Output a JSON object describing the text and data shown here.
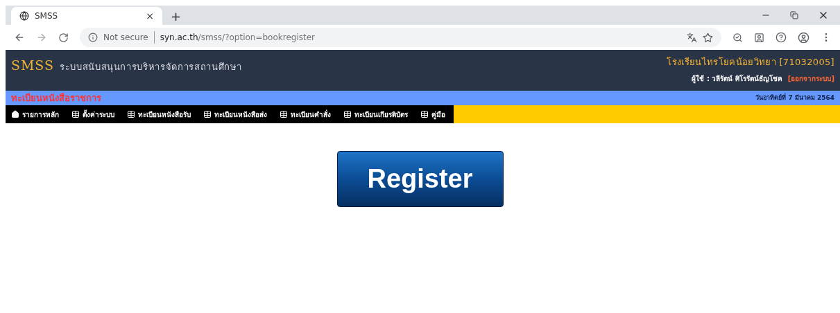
{
  "browser": {
    "tab": {
      "title": "SMSS",
      "close": "×"
    },
    "new_tab": "+",
    "address": {
      "security": "Not secure",
      "host": "syn.ac.th",
      "path": "/smss/?option=bookregister"
    }
  },
  "header": {
    "logo": "SMSS",
    "system_name": "ระบบสนับสนุนการบริหารจัดการสถานศึกษา",
    "school": "โรงเรียนไทรโยคน้อยวิทยา [71032005]",
    "user": "ผู้ใช้ : วลีรัตน์ ศิโรรัตน์ธัญโชค",
    "logout": "[ออกจากระบบ]"
  },
  "subheader": {
    "title": "ทะเบียนหนังสือราชการ",
    "date": "วันอาทิตย์ที่ 7 มีนาคม 2564"
  },
  "menu": [
    {
      "kind": "home",
      "label": "รายการหลัก"
    },
    {
      "kind": "table",
      "label": "ตั้งค่าระบบ"
    },
    {
      "kind": "table",
      "label": "ทะเบียนหนังสือรับ"
    },
    {
      "kind": "table",
      "label": "ทะเบียนหนังสือส่ง"
    },
    {
      "kind": "table",
      "label": "ทะเบียนคำสั่ง"
    },
    {
      "kind": "table",
      "label": "ทะเบียนเกียรติบัตร"
    },
    {
      "kind": "table",
      "label": "คู่มือ"
    }
  ],
  "register_button": "Register"
}
